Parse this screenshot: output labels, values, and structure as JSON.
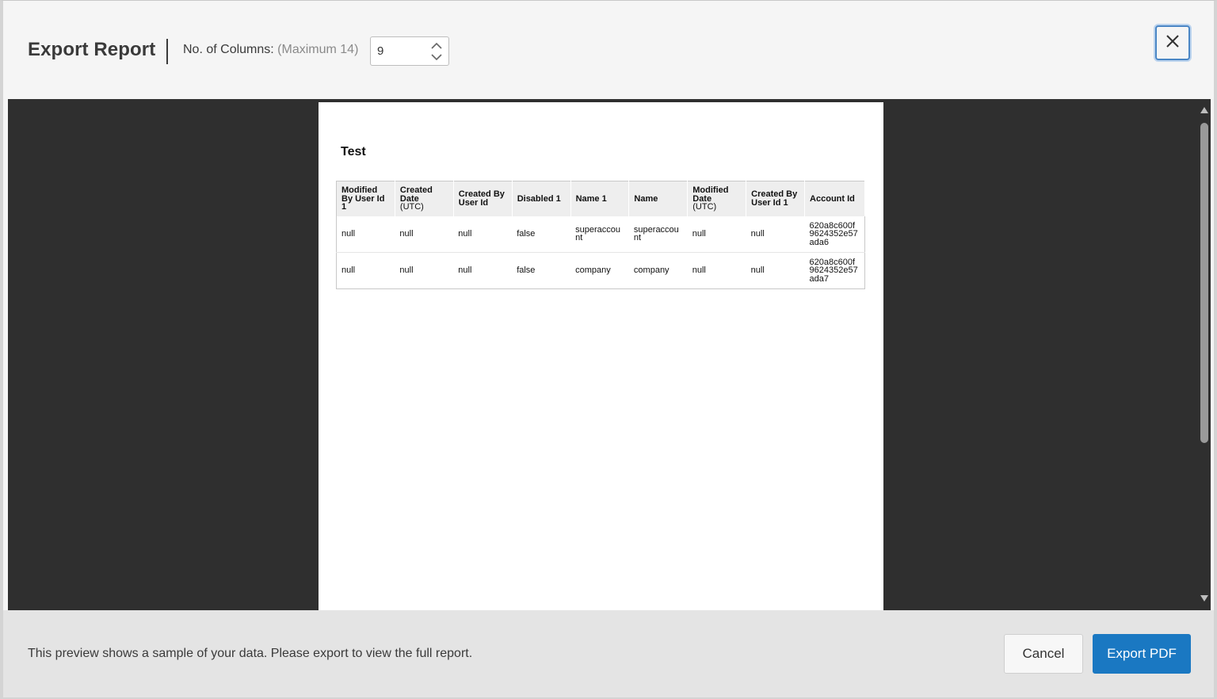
{
  "header": {
    "title": "Export Report",
    "columns_label": "No. of Columns:",
    "columns_hint": "(Maximum 14)",
    "columns_value": "9"
  },
  "icons": {
    "close": "close-icon",
    "stepper_up": "chevron-up-icon",
    "stepper_down": "chevron-down-icon",
    "scroll_up": "triangle-up-icon",
    "scroll_down": "triangle-down-icon"
  },
  "report": {
    "title": "Test",
    "columns": [
      {
        "label": "Modified By User Id 1",
        "sub": ""
      },
      {
        "label": "Created Date",
        "sub": "(UTC)"
      },
      {
        "label": "Created By User Id",
        "sub": ""
      },
      {
        "label": "Disabled 1",
        "sub": ""
      },
      {
        "label": "Name 1",
        "sub": ""
      },
      {
        "label": "Name",
        "sub": ""
      },
      {
        "label": "Modified Date",
        "sub": "(UTC)"
      },
      {
        "label": "Created By User Id 1",
        "sub": ""
      },
      {
        "label": "Account Id",
        "sub": ""
      }
    ],
    "rows": [
      [
        "null",
        "null",
        "null",
        "false",
        "superaccount",
        "superaccount",
        "null",
        "null",
        "620a8c600f9624352e57ada6"
      ],
      [
        "null",
        "null",
        "null",
        "false",
        "company",
        "company",
        "null",
        "null",
        "620a8c600f9624352e57ada7"
      ]
    ]
  },
  "footer": {
    "note": "This preview shows a sample of your data. Please export to view the full report.",
    "cancel_label": "Cancel",
    "export_label": "Export PDF"
  },
  "colors": {
    "accent": "#1a78c2",
    "preview_bg": "#2f2f2f",
    "focus_border": "#4a86c5"
  }
}
